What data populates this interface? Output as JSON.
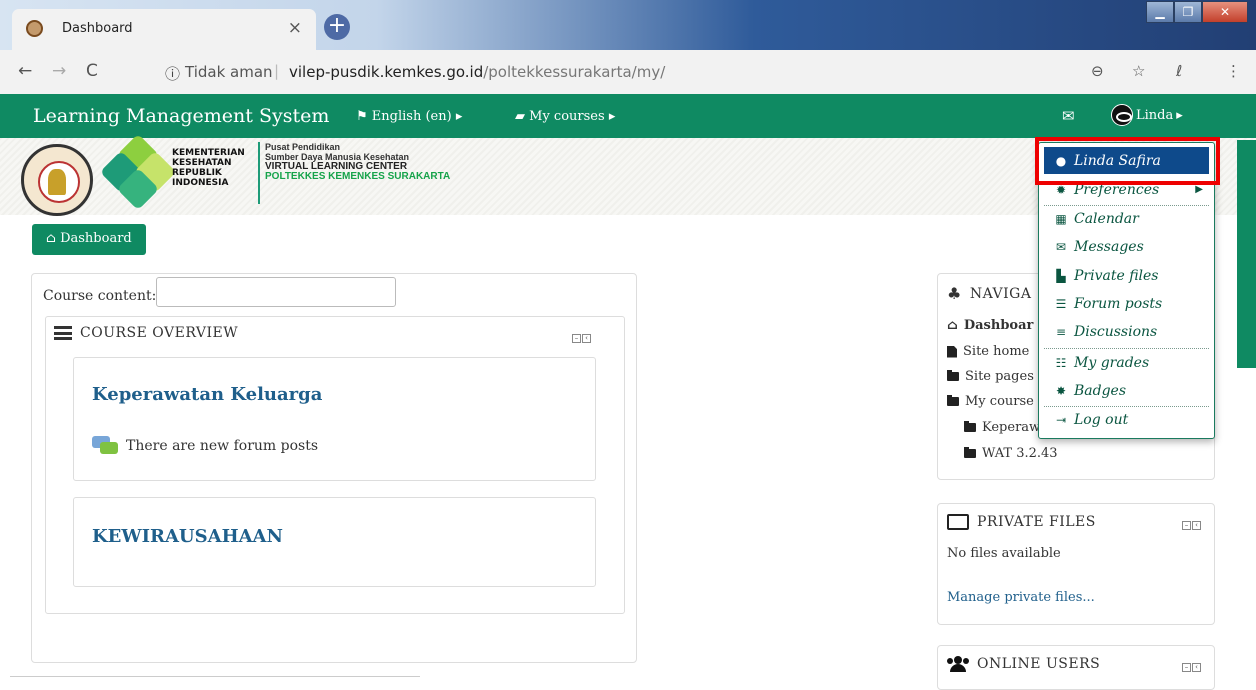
{
  "browser": {
    "tab_title": "Dashboard",
    "tab_close": "×",
    "new_tab": "+",
    "win_min": "▁",
    "win_max": "❐",
    "win_close": "✕",
    "back": "←",
    "forward": "→",
    "reload": "C",
    "info_icon": "ⓘ",
    "not_secure": "Tidak aman",
    "separator": "|",
    "url_host": "vilep-pusdik.kemkes.go.id",
    "url_path": "/poltekkessurakarta/my/",
    "zoom_icon": "⊖",
    "star_icon": "☆",
    "ext_icon": "ℓ",
    "menu_icon": "⋮"
  },
  "navbar": {
    "brand": "Learning Management System",
    "language": "English (en)",
    "my_courses": "My courses",
    "mail_icon": "✉",
    "user": "Linda"
  },
  "header": {
    "kementerian": [
      "KEMENTERIAN",
      "KESEHATAN",
      "REPUBLIK",
      "INDONESIA"
    ],
    "pusat": [
      "Pusat Pendidikan",
      "Sumber Daya Manusia Kesehatan",
      "VIRTUAL LEARNING CENTER",
      "POLTEKKES KEMENKES SURAKARTA"
    ]
  },
  "breadcrumb": {
    "label": "Dashboard"
  },
  "main": {
    "course_content_label": "Course content:",
    "course_content_value": "",
    "overview_title": "COURSE OVERVIEW",
    "courses": [
      {
        "name": "Keperawatan Keluarga",
        "note": "There are new forum posts"
      },
      {
        "name": "KEWIRAUSAHAAN"
      }
    ]
  },
  "navigation_block": {
    "title": "NAVIGA",
    "items": [
      "Dashboar",
      "Site home",
      "Site pages",
      "My course",
      "Keperaw",
      "WAT 3.2.43"
    ]
  },
  "private_files": {
    "title": "PRIVATE FILES",
    "empty": "No files available",
    "manage": "Manage private files..."
  },
  "online_users": {
    "title": "ONLINE USERS"
  },
  "user_menu": {
    "items": [
      {
        "label": "Linda Safira",
        "icon": "user-icon"
      },
      {
        "label": "Preferences",
        "icon": "gear-icon"
      },
      {
        "label": "Calendar",
        "icon": "calendar-icon"
      },
      {
        "label": "Messages",
        "icon": "envelope-icon"
      },
      {
        "label": "Private files",
        "icon": "file-icon"
      },
      {
        "label": "Forum posts",
        "icon": "list-icon"
      },
      {
        "label": "Discussions",
        "icon": "list-icon"
      },
      {
        "label": "My grades",
        "icon": "table-icon"
      },
      {
        "label": "Badges",
        "icon": "badge-icon"
      },
      {
        "label": "Log out",
        "icon": "logout-icon"
      }
    ]
  },
  "colors": {
    "brand_green": "#0f8a62",
    "highlight_blue": "#0e4a8b",
    "annotation_red": "#ee0000",
    "link_blue": "#1f5f8b"
  }
}
